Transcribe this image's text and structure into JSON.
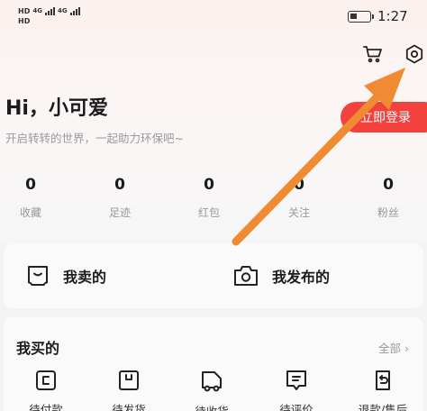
{
  "status_bar": {
    "sims": [
      {
        "badge": "HD",
        "network": "4G"
      },
      {
        "badge": "HD",
        "network": "4G"
      }
    ],
    "time": "1:27"
  },
  "header": {
    "icons": [
      "cart-icon",
      "settings-icon"
    ]
  },
  "profile": {
    "greeting": "Hi，小可爱",
    "subtitle": "开启转转的世界，一起助力环保吧~",
    "login_label": "立即登录"
  },
  "stats": [
    {
      "value": "0",
      "label": "收藏"
    },
    {
      "value": "0",
      "label": "足迹"
    },
    {
      "value": "0",
      "label": "红包"
    },
    {
      "value": "0",
      "label": "关注"
    },
    {
      "value": "0",
      "label": "粉丝"
    }
  ],
  "quick_actions": {
    "sold": {
      "label": "我卖的",
      "icon": "bag-icon"
    },
    "published": {
      "label": "我发布的",
      "icon": "camera-icon"
    }
  },
  "bought": {
    "title": "我买的",
    "all_label": "全部 ›",
    "orders": [
      {
        "label": "待付款",
        "icon": "wallet-icon"
      },
      {
        "label": "待发货",
        "icon": "package-icon"
      },
      {
        "label": "待收货",
        "icon": "truck-icon"
      },
      {
        "label": "待评价",
        "icon": "comment-icon"
      },
      {
        "label": "退款/售后",
        "icon": "refund-icon"
      }
    ]
  },
  "colors": {
    "accent": "#f3413d",
    "annotation_arrow": "#f08a33"
  }
}
